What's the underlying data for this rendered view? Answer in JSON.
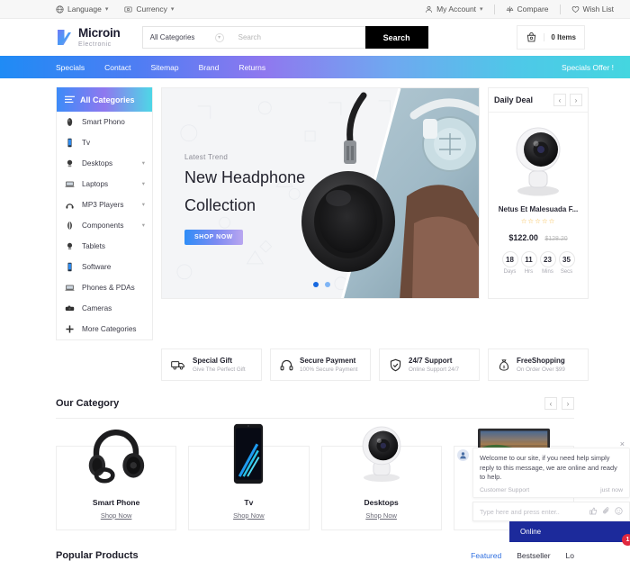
{
  "topbar": {
    "language": "Language",
    "currency": "Currency",
    "my_account": "My Account",
    "compare": "Compare",
    "wish_list": "Wish List"
  },
  "header": {
    "logo_main": "Microin",
    "logo_sub": "Electronic",
    "category_select": "All Categories",
    "search_placeholder": "Search",
    "search_value": "",
    "search_button": "Search",
    "cart_items": "0 Items"
  },
  "nav": {
    "items": [
      "Specials",
      "Contact",
      "Sitemap",
      "Brand",
      "Returns"
    ],
    "promo": "Specials Offer !"
  },
  "sidebar": {
    "header": "All Categories",
    "items": [
      {
        "label": "Smart Phono",
        "icon": "smartphone-icon",
        "caret": false
      },
      {
        "label": "Tv",
        "icon": "tv-icon",
        "caret": false
      },
      {
        "label": "Desktops",
        "icon": "desktop-icon",
        "caret": true
      },
      {
        "label": "Laptops",
        "icon": "laptop-icon",
        "caret": true
      },
      {
        "label": "MP3 Players",
        "icon": "mp3-icon",
        "caret": true
      },
      {
        "label": "Components",
        "icon": "components-icon",
        "caret": true
      },
      {
        "label": "Tablets",
        "icon": "tablet-icon",
        "caret": false
      },
      {
        "label": "Software",
        "icon": "software-icon",
        "caret": false
      },
      {
        "label": "Phones & PDAs",
        "icon": "phones-pda-icon",
        "caret": false
      },
      {
        "label": "Cameras",
        "icon": "camera-icon",
        "caret": false
      },
      {
        "label": "More Categories",
        "icon": "plus-icon",
        "caret": false
      }
    ]
  },
  "hero": {
    "kicker": "Latest Trend",
    "title_line1": "New Headphone",
    "title_line2": "Collection",
    "cta": "SHOP NOW",
    "slide_index": 1,
    "slide_total": 2
  },
  "daily_deal": {
    "title": "Daily Deal",
    "prev": "‹",
    "next": "›",
    "product_name": "Netus Et Malesuada F...",
    "rating_stars": 5,
    "price_new": "$122.00",
    "price_old": "$128.20",
    "countdown": [
      {
        "value": "18",
        "label": "Days"
      },
      {
        "value": "11",
        "label": "Hrs"
      },
      {
        "value": "23",
        "label": "Mins"
      },
      {
        "value": "35",
        "label": "Secs"
      }
    ]
  },
  "features": [
    {
      "title": "Special Gift",
      "subtitle": "Give The Perfect Gift",
      "icon": "truck-icon"
    },
    {
      "title": "Secure Payment",
      "subtitle": "100% Secure Payment",
      "icon": "headset-icon"
    },
    {
      "title": "24/7 Support",
      "subtitle": "Online Support 24/7",
      "icon": "shield-check-icon"
    },
    {
      "title": "FreeShopping",
      "subtitle": "On Order Over $99",
      "icon": "money-bag-icon"
    }
  ],
  "our_category": {
    "title": "Our Category",
    "prev": "‹",
    "next": "›",
    "cards": [
      {
        "name": "Smart Phone",
        "link": "Shop Now",
        "image": "headphones-image"
      },
      {
        "name": "Tv",
        "link": "Shop Now",
        "image": "smartphone-image"
      },
      {
        "name": "Desktops",
        "link": "Shop Now",
        "image": "webcam-image"
      },
      {
        "name": "",
        "link": "",
        "image": "monitor-landscape-image"
      }
    ]
  },
  "popular": {
    "title": "Popular Products",
    "tabs": [
      {
        "label": "Featured",
        "active": true
      },
      {
        "label": "Bestseller",
        "active": false
      },
      {
        "label": "Lo",
        "active": false
      }
    ]
  },
  "chat": {
    "close": "×",
    "message": "Welcome to our site, if you need help simply reply to this message, we are online and ready to help.",
    "sender": "Customer Support",
    "time": "just now",
    "input_placeholder": "Type here and press enter..",
    "status": "Online",
    "badge": "1"
  },
  "colors": {
    "accent_blue": "#2f6fe0",
    "nav_gradient_start": "#1f8bf5",
    "nav_gradient_mid": "#8f78ef",
    "nav_gradient_end": "#44d6e0",
    "chat_bar": "#1c2a9b",
    "badge_red": "#e0283f",
    "star_gold": "#f5b942",
    "search_btn": "#000000"
  }
}
